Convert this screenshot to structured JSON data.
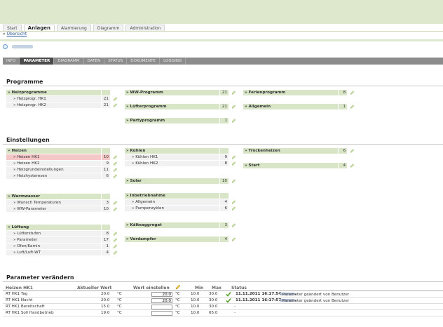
{
  "main_tabs": [
    "Start",
    "Anlagen",
    "Alarmierung",
    "Diagramm",
    "Administration"
  ],
  "breadcrumb": "Übersicht",
  "sub_tabs": [
    "INFO",
    "PARAMETER",
    "DIAGRAMM",
    "DATEN",
    "STATUS",
    "DOKUMENTE",
    "LOGGING"
  ],
  "sections": {
    "programme": "Programme",
    "einstellungen": "Einstellungen",
    "parameter": "Parameter verändern"
  },
  "programme": {
    "heiz": {
      "header": "» Heizprogramme",
      "items": [
        {
          "label": "» Heizprogr. HK1",
          "count": "21"
        },
        {
          "label": "» Heizprogr. HK2",
          "count": "21"
        }
      ]
    },
    "ww": {
      "label": "» WW-Programm",
      "count": "21"
    },
    "luefter": {
      "label": "» Lüfterprogramm",
      "count": "21"
    },
    "party": {
      "label": "» Partyprogramm",
      "count": "1"
    },
    "ferien": {
      "label": "» Ferienprogramm",
      "count": "8"
    },
    "allgemein": {
      "label": "» Allgemein",
      "count": "1"
    }
  },
  "einstellungen": {
    "heizen": {
      "header": "» Heizen",
      "items": [
        {
          "label": "» Heizen HK1",
          "count": "10"
        },
        {
          "label": "» Heizen HK2",
          "count": "9"
        },
        {
          "label": "» Heizgrundeinstellungen",
          "count": "11"
        },
        {
          "label": "» Heizhysteresen",
          "count": "6"
        }
      ]
    },
    "warmwasser": {
      "header": "» Warmwasser",
      "items": [
        {
          "label": "» Wunsch Temperaturen",
          "count": "3"
        },
        {
          "label": "» WW-Parameter",
          "count": "10"
        }
      ]
    },
    "lueftung": {
      "header": "» Lüftung",
      "items": [
        {
          "label": "» Lüfterstufen",
          "count": "8"
        },
        {
          "label": "» Parameter",
          "count": "17"
        },
        {
          "label": "» Ofen/Kamin",
          "count": "1"
        },
        {
          "label": "» Luft/Luft-WT",
          "count": "4"
        }
      ]
    },
    "kuehlen": {
      "header": "» Kühlen",
      "items": [
        {
          "label": "» Kühlen HK1",
          "count": "9"
        },
        {
          "label": "» Kühlen HK2",
          "count": "8"
        }
      ]
    },
    "solar": {
      "label": "» Solar",
      "count": "10"
    },
    "inbetrieb": {
      "header": "» Inbetriebnahme",
      "items": [
        {
          "label": "» Allgemein",
          "count": "4"
        },
        {
          "label": "» Pumpenzyklen",
          "count": "6"
        }
      ]
    },
    "kaelte": {
      "label": "» Kälteaggregat",
      "count": "3"
    },
    "verdampfer": {
      "label": "» Verdampfer",
      "count": "4"
    },
    "trocken": {
      "label": "» Trockenheizen",
      "count": "6"
    },
    "start": {
      "label": "» Start",
      "count": "4"
    }
  },
  "param_table": {
    "headers": {
      "name": "Heizen HK1",
      "current": "Aktueller Wert",
      "set": "Wert einstellen",
      "min": "Min",
      "max": "Max",
      "status": "Status"
    },
    "rows": [
      {
        "name": "RT HK1 Tag",
        "current": "20.0",
        "unit": "°C",
        "input": "20.0",
        "min": "10.0",
        "max": "30.0",
        "date": "11.11.2011 16:17:54",
        "status": "- Parameter geändert von Benutzer"
      },
      {
        "name": "RT HK1 Nacht",
        "current": "20.0",
        "unit": "°C",
        "input": "20.0",
        "min": "10.0",
        "max": "30.0",
        "date": "11.11.2011 16:17:57",
        "status": "- Parameter geändert von Benutzer"
      },
      {
        "name": "RT HK1 Bereitschaft",
        "current": "15.0",
        "unit": "°C",
        "input": "",
        "min": "10.0",
        "max": "30.0",
        "date": "",
        "status": "-"
      },
      {
        "name": "RT HK1 Soll Handbetrieb",
        "current": "19.0",
        "unit": "°C",
        "input": "",
        "min": "10.0",
        "max": "65.0",
        "date": "",
        "status": "-"
      }
    ]
  }
}
